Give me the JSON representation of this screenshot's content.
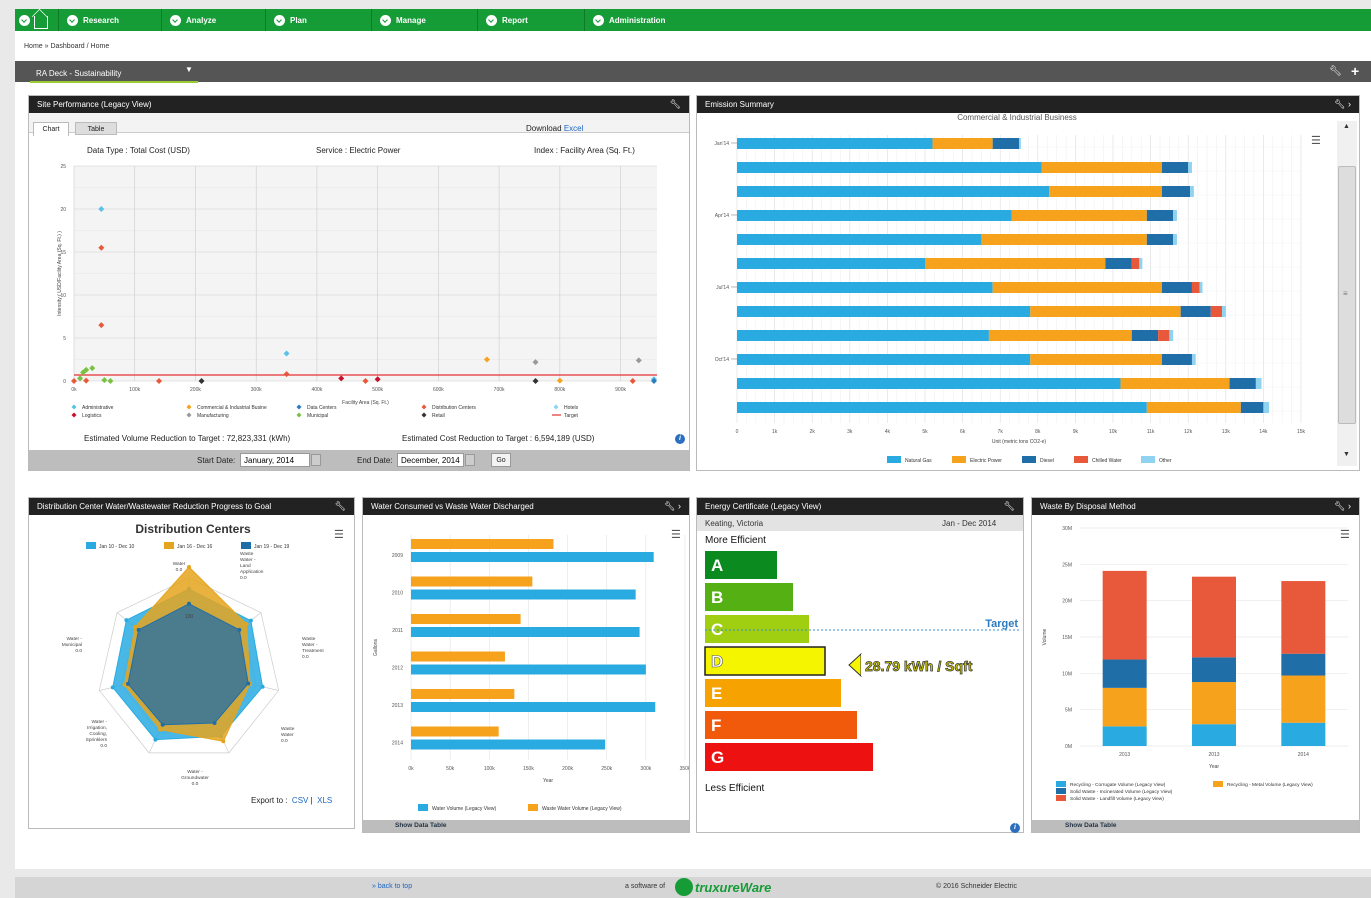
{
  "nav": {
    "items": [
      "Research",
      "Analyze",
      "Plan",
      "Manage",
      "Report",
      "Administration"
    ]
  },
  "breadcrumb": "Home » Dashboard / Home",
  "deck": {
    "title": "RA Deck - Sustainability"
  },
  "site_perf": {
    "title": "Site Performance (Legacy View)",
    "tabs": [
      "Chart",
      "Table"
    ],
    "download": "Download",
    "excel": "Excel",
    "data_type": "Data Type : Total Cost (USD)",
    "service": "Service : Electric Power",
    "index": "Index : Facility Area (Sq. Ft.)",
    "ylabel": "Intensity ( USD/Facility Area (Sq. Ft.) )",
    "xlabel": "Facility Area (Sq. Ft.)",
    "vol_reduction": "Estimated Volume Reduction to Target : 72,823,331 (kWh)",
    "cost_reduction": "Estimated Cost Reduction to Target : 6,594,189 (USD)",
    "start_label": "Start Date:",
    "start_value": "January, 2014",
    "end_label": "End Date:",
    "end_value": "December, 2014",
    "go": "Go",
    "legend": [
      {
        "name": "Administrative",
        "color": "#5bc2e7"
      },
      {
        "name": "Commercial & Industrial Busine",
        "color": "#f6a21d"
      },
      {
        "name": "Data Centers",
        "color": "#2c7dbf"
      },
      {
        "name": "Distribution Centers",
        "color": "#e8583a"
      },
      {
        "name": "Hotels",
        "color": "#8fd3f0"
      },
      {
        "name": "Logistics",
        "color": "#c8102e"
      },
      {
        "name": "Manufacturing",
        "color": "#999999"
      },
      {
        "name": "Municipal",
        "color": "#7ac143"
      },
      {
        "name": "Retail",
        "color": "#333333"
      },
      {
        "name": "Target",
        "color": "#e63232"
      }
    ]
  },
  "emission": {
    "title": "Emission Summary",
    "chart_title": "Commercial & Industrial Business",
    "xlabel": "Unit (metric tons CO2-e)",
    "legend": [
      {
        "name": "Natural Gas",
        "color": "#29abe2"
      },
      {
        "name": "Electric Power",
        "color": "#f6a21d"
      },
      {
        "name": "Diesel",
        "color": "#1f6ea8"
      },
      {
        "name": "Chilled Water",
        "color": "#e8583a"
      },
      {
        "name": "Other",
        "color": "#8fd3f0"
      }
    ]
  },
  "dist": {
    "title": "Distribution Center Water/Wastewater Reduction Progress to Goal",
    "chart_title": "Distribution Centers",
    "export": "Export to :",
    "csv": "CSV",
    "xls": "XLS",
    "legend": [
      {
        "name": "Jan 10 - Dec 10",
        "color": "#29abe2"
      },
      {
        "name": "Jan 16 - Dec 16",
        "color": "#e5a41d"
      },
      {
        "name": "Jan 19 - Dec 19",
        "color": "#1f6ea8"
      }
    ]
  },
  "water": {
    "title": "Water Consumed vs Waste Water Discharged",
    "ylabel": "Gallons",
    "xlabel": "Year",
    "show_table": "Show Data Table",
    "legend": [
      {
        "name": "Water Volume (Legacy View)",
        "color": "#29abe2"
      },
      {
        "name": "Waste Water Volume (Legacy View)",
        "color": "#f6a21d"
      }
    ]
  },
  "energy": {
    "title": "Energy Certificate (Legacy View)",
    "location": "Keating, Victoria",
    "period": "Jan - Dec 2014",
    "more": "More Efficient",
    "less": "Less Efficient",
    "target": "Target",
    "value": "28.79 kWh / Sqft",
    "grades": [
      {
        "letter": "A",
        "color": "#0b8a1f"
      },
      {
        "letter": "B",
        "color": "#55b014"
      },
      {
        "letter": "C",
        "color": "#9fcf10"
      },
      {
        "letter": "D",
        "color": "#f5f500"
      },
      {
        "letter": "E",
        "color": "#f6a200"
      },
      {
        "letter": "F",
        "color": "#f05a0a"
      },
      {
        "letter": "G",
        "color": "#ee1111"
      }
    ]
  },
  "waste": {
    "title": "Waste By Disposal Method",
    "ylabel": "Volume",
    "xlabel": "Year",
    "show_table": "Show Data Table",
    "legend": [
      {
        "name": "Recycling - Corrugate Volume (Legacy View)",
        "color": "#29abe2"
      },
      {
        "name": "Recycling - Metal Volume (Legacy View)",
        "color": "#f6a21d"
      },
      {
        "name": "Solid Waste - Incinerated Volume (Legacy View)",
        "color": "#1f6ea8"
      },
      {
        "name": "Solid Waste - Landfill Volume (Legacy View)",
        "color": "#e8583a"
      }
    ]
  },
  "footer": {
    "back": "» back to top",
    "software": "a software of",
    "brand": "truxureWare",
    "copyright": "© 2016 Schneider Electric"
  },
  "chart_data": [
    {
      "type": "scatter",
      "title": "",
      "xlabel": "Facility Area (Sq. Ft.)",
      "ylabel": "Intensity ( USD/Facility Area (Sq. Ft.) )",
      "xlim": [
        0,
        960000
      ],
      "ylim": [
        0,
        25
      ],
      "x_ticks": [
        "0k",
        "100k",
        "200k",
        "300k",
        "400k",
        "500k",
        "600k",
        "700k",
        "800k",
        "900k"
      ],
      "y_ticks": [
        "0",
        "5",
        "10",
        "15",
        "20",
        "25"
      ],
      "target": 0.7,
      "series": [
        {
          "name": "Administrative",
          "points": [
            [
              45000,
              20
            ],
            [
              350000,
              3.2
            ],
            [
              955000,
              0.2
            ]
          ]
        },
        {
          "name": "Commercial & Industrial Busine",
          "points": [
            [
              680000,
              2.5
            ],
            [
              800000,
              0.05
            ]
          ]
        },
        {
          "name": "Data Centers",
          "points": [
            [
              955000,
              0
            ]
          ]
        },
        {
          "name": "Distribution Centers",
          "points": [
            [
              45000,
              15.5
            ],
            [
              45000,
              6.5
            ],
            [
              0,
              0
            ],
            [
              20000,
              0.05
            ],
            [
              140000,
              0
            ],
            [
              350000,
              0.8
            ],
            [
              480000,
              0
            ],
            [
              920000,
              0
            ]
          ]
        },
        {
          "name": "Hotels",
          "points": []
        },
        {
          "name": "Logistics",
          "points": [
            [
              440000,
              0.3
            ],
            [
              500000,
              0.2
            ]
          ]
        },
        {
          "name": "Manufacturing",
          "points": [
            [
              760000,
              2.2
            ],
            [
              930000,
              2.4
            ]
          ]
        },
        {
          "name": "Municipal",
          "points": [
            [
              15000,
              1.0
            ],
            [
              20000,
              1.3
            ],
            [
              30000,
              1.5
            ],
            [
              10000,
              0.3
            ],
            [
              50000,
              0.1
            ],
            [
              60000,
              0
            ]
          ]
        },
        {
          "name": "Retail",
          "points": [
            [
              210000,
              0
            ],
            [
              760000,
              0
            ]
          ]
        }
      ]
    },
    {
      "type": "bar",
      "title": "Commercial & Industrial Business",
      "xlabel": "Unit (metric tons CO2-e)",
      "xlim": [
        0,
        15000
      ],
      "x_ticks": [
        "0",
        "1k",
        "2k",
        "3k",
        "4k",
        "5k",
        "6k",
        "7k",
        "8k",
        "9k",
        "10k",
        "11k",
        "12k",
        "13k",
        "14k",
        "15k"
      ],
      "y_ticks": [
        "Jan'14",
        "Apr'14",
        "Jul'14",
        "Oct'14"
      ],
      "series": [
        {
          "name": "Natural Gas",
          "values": [
            5200,
            8100,
            8300,
            7300,
            6500,
            5000,
            6800,
            7800,
            6700,
            7800,
            10200,
            10900
          ]
        },
        {
          "name": "Electric Power",
          "values": [
            1600,
            3200,
            3000,
            3600,
            4400,
            4800,
            4500,
            4000,
            3800,
            3500,
            2900,
            2500
          ]
        },
        {
          "name": "Diesel",
          "values": [
            700,
            700,
            750,
            700,
            700,
            700,
            800,
            800,
            700,
            800,
            700,
            600
          ]
        },
        {
          "name": "Chilled Water",
          "values": [
            0,
            0,
            0,
            0,
            0,
            200,
            200,
            300,
            300,
            0,
            0,
            0
          ]
        },
        {
          "name": "Other",
          "values": [
            50,
            100,
            100,
            100,
            100,
            80,
            80,
            100,
            100,
            100,
            150,
            150
          ]
        }
      ]
    },
    {
      "type": "radar",
      "title": "Distribution Centers",
      "axes": [
        "Water 0.0",
        "Waste Water - Land Application 0.0",
        "Waste Water - Treatment 0.0",
        "Waste Water 0.0",
        "Water - Groundwater 0.0",
        "Water - Irrigation, Cooling, Sprinklers 0.0",
        "Water - Municipal 0.0"
      ],
      "scale_label": "100",
      "series": [
        {
          "name": "Jan 10 - Dec 10",
          "values": [
            0.88,
            0.86,
            0.82,
            0.8,
            0.84,
            0.85,
            0.87
          ]
        },
        {
          "name": "Jan 16 - Dec 16",
          "values": [
            1.12,
            0.8,
            0.68,
            0.86,
            0.72,
            0.72,
            0.75
          ]
        },
        {
          "name": "Jan 19 - Dec 19",
          "values": [
            0.72,
            0.7,
            0.66,
            0.64,
            0.66,
            0.68,
            0.7
          ]
        }
      ]
    },
    {
      "type": "bar",
      "title": "",
      "xlabel": "Year",
      "ylabel": "Gallons",
      "xlim": [
        0,
        350000
      ],
      "x_ticks": [
        "0k",
        "50k",
        "100k",
        "150k",
        "200k",
        "250k",
        "300k",
        "350k"
      ],
      "categories": [
        "2009",
        "2010",
        "2011",
        "2012",
        "2013",
        "2014"
      ],
      "series": [
        {
          "name": "Waste Water Volume (Legacy View)",
          "values": [
            182000,
            155000,
            140000,
            120000,
            132000,
            112000
          ]
        },
        {
          "name": "Water Volume (Legacy View)",
          "values": [
            310000,
            287000,
            292000,
            300000,
            312000,
            248000
          ]
        }
      ]
    },
    {
      "type": "bar",
      "title": "",
      "xlabel": "Year",
      "ylabel": "Volume",
      "ylim": [
        0,
        30000000
      ],
      "y_ticks": [
        "0M",
        "5M",
        "10M",
        "15M",
        "20M",
        "25M",
        "30M"
      ],
      "categories": [
        "2013",
        "2013",
        "2014"
      ],
      "series": [
        {
          "name": "Recycling - Corrugate Volume (Legacy View)",
          "values": [
            2700000,
            3000000,
            3200000
          ]
        },
        {
          "name": "Recycling - Metal Volume (Legacy View)",
          "values": [
            5300000,
            5800000,
            6500000
          ]
        },
        {
          "name": "Solid Waste - Incinerated Volume (Legacy View)",
          "values": [
            3900000,
            3400000,
            3000000
          ]
        },
        {
          "name": "Solid Waste - Landfill Volume (Legacy View)",
          "values": [
            12200000,
            11100000,
            10000000
          ]
        }
      ]
    }
  ]
}
